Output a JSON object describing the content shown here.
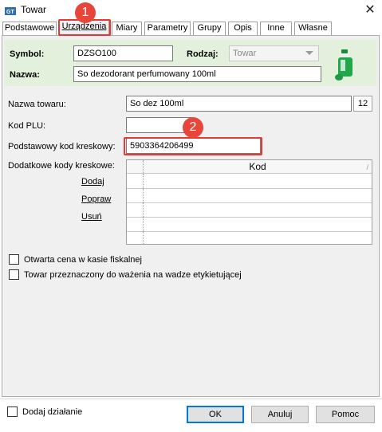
{
  "window": {
    "title": "Towar",
    "close_glyph": "✕",
    "app_icon": "gt-app-icon"
  },
  "tabs": [
    {
      "label": "Podstawowe",
      "active": false
    },
    {
      "label": "Urządzenia",
      "active": true
    },
    {
      "label": "Miary",
      "active": false
    },
    {
      "label": "Parametry",
      "active": false
    },
    {
      "label": "Grupy",
      "active": false
    },
    {
      "label": "Opis",
      "active": false
    },
    {
      "label": "Inne",
      "active": false
    },
    {
      "label": "Własne",
      "active": false
    }
  ],
  "header": {
    "symbol_label": "Symbol:",
    "symbol_value": "DZSO100",
    "rodzaj_label": "Rodzaj:",
    "rodzaj_value": "Towar",
    "nazwa_label": "Nazwa:",
    "nazwa_value": "So dezodorant perfumowany 100ml",
    "product_image": "deodorant-bottle-image"
  },
  "form": {
    "nazwa_towaru_label": "Nazwa towaru:",
    "nazwa_towaru_value": "So dez 100ml",
    "nazwa_towaru_counter": "12",
    "kod_plu_label": "Kod PLU:",
    "kod_plu_value": "",
    "barcode_label": "Podstawowy kod kreskowy:",
    "barcode_value": "5903364206499",
    "extra_codes_label": "Dodatkowe kody kreskowe:",
    "links": {
      "add": "Dodaj",
      "edit": "Popraw",
      "delete": "Usuń"
    },
    "grid": {
      "column": "Kod",
      "sort_mark": "/",
      "rows": [
        "",
        "",
        "",
        "",
        ""
      ]
    },
    "checkboxes": [
      {
        "label": "Otwarta cena w kasie fiskalnej",
        "checked": false
      },
      {
        "label": "Towar przeznaczony do ważenia na wadze etykietującej",
        "checked": false
      }
    ]
  },
  "footer": {
    "add_action_label": "Dodaj działanie",
    "add_action_checked": false,
    "ok": "OK",
    "cancel": "Anuluj",
    "help": "Pomoc"
  },
  "annotations": {
    "badge1": "1",
    "badge2": "2",
    "color": "#e53935"
  },
  "colors": {
    "header_band": "#e3f1dc",
    "panel": "#f0f0f0",
    "accent": "#0078d7"
  }
}
